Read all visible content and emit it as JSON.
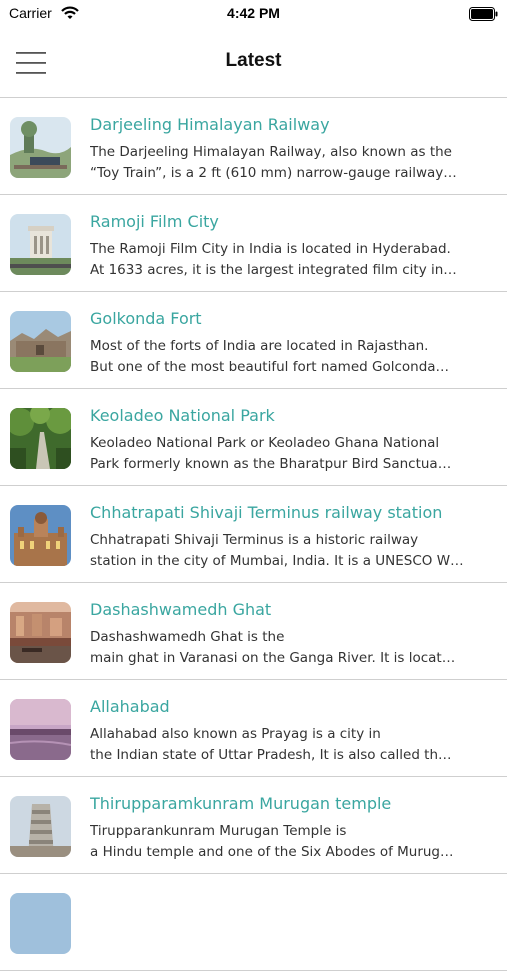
{
  "status_bar": {
    "carrier": "Carrier",
    "time": "4:42 PM",
    "wifi_icon": "wifi-icon",
    "battery_icon": "battery-full-icon"
  },
  "nav": {
    "title": "Latest",
    "menu_icon": "hamburger-menu-icon"
  },
  "colors": {
    "title_teal": "#3aa6a0",
    "divider": "#cfcfcf"
  },
  "items": [
    {
      "title": "Darjeeling Himalayan Railway",
      "line1": "The Darjeeling Himalayan Railway, also known as the",
      "line2": "“Toy Train”, is a 2 ft (610 mm) narrow-gauge railway…"
    },
    {
      "title": "Ramoji Film City",
      "line1": "The Ramoji Film City in India is located in Hyderabad.",
      "line2": "At 1633 acres, it is the largest integrated film city in…"
    },
    {
      "title": "Golkonda Fort",
      "line1": "Most of the forts of India are located in Rajasthan.",
      "line2": "But one of the most beautiful fort named Golconda…"
    },
    {
      "title": "Keoladeo National Park",
      "line1": "Keoladeo National Park or Keoladeo Ghana National",
      "line2": "Park formerly known as the Bharatpur Bird Sanctua…"
    },
    {
      "title": "Chhatrapati Shivaji Terminus railway station",
      "line1": "Chhatrapati Shivaji Terminus is a historic railway",
      "line2": "station in the city of Mumbai, India. It is a UNESCO W…"
    },
    {
      "title": "Dashashwamedh Ghat",
      "line1": "Dashashwamedh Ghat is the",
      "line2": "main ghat in Varanasi on the Ganga River. It is locat…"
    },
    {
      "title": "Allahabad",
      "line1": "Allahabad  also known as Prayag is a city in",
      "line2": "the Indian state of Uttar Pradesh, It is also called th…"
    },
    {
      "title": "Thirupparamkunram Murugan temple",
      "line1": "Tirupparankunram Murugan Temple is",
      "line2": "a Hindu temple and one of the Six Abodes of Murug…"
    }
  ]
}
